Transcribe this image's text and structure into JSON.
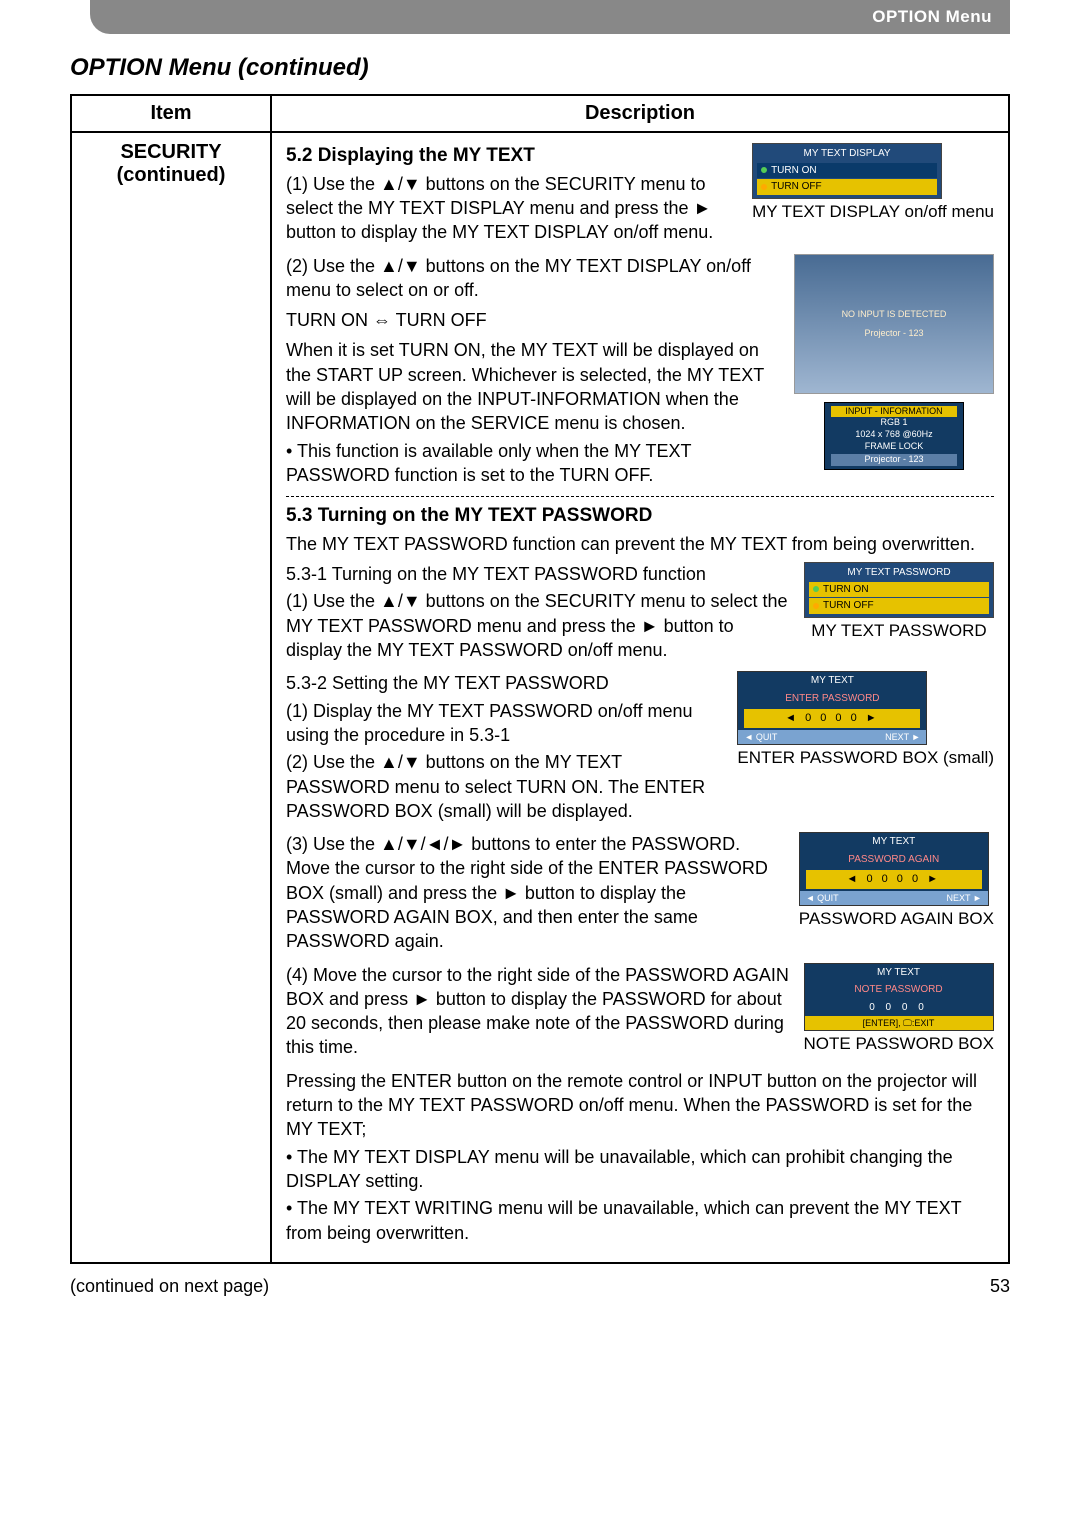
{
  "topbar": {
    "label": "OPTION Menu"
  },
  "sectionTitle": "OPTION Menu (continued)",
  "headers": {
    "item": "Item",
    "description": "Description"
  },
  "item": {
    "title": "SECURITY",
    "sub": "(continued)"
  },
  "s52": {
    "heading": "5.2 Displaying the MY TEXT",
    "p1": "(1) Use the ▲/▼ buttons on the SECURITY menu to select the MY TEXT DISPLAY menu and press the ► button to display the MY TEXT DISPLAY on/off menu.",
    "p2": "(2) Use the ▲/▼ buttons on the MY TEXT DISPLAY on/off menu to select on or off.",
    "toggle": "TURN ON ⇔ TURN OFF",
    "p3": "When it is set TURN ON, the MY TEXT will be displayed on the START UP screen. Whichever is selected, the MY TEXT will be displayed on the INPUT-INFORMATION when the INFORMATION on the SERVICE menu is chosen.",
    "p4": "• This function is available only when the MY TEXT PASSWORD function is set to the TURN OFF.",
    "fig1": {
      "title": "MY TEXT DISPLAY",
      "on": "TURN ON",
      "off": "TURN OFF",
      "caption": "MY TEXT DISPLAY on/off menu"
    },
    "fig2": {
      "screenLine1": "NO INPUT IS DETECTED",
      "screenLine2": "Projector - 123",
      "infoTitle": "INPUT - INFORMATION",
      "info1": "RGB 1",
      "info2": "1024 x 768 @60Hz",
      "info3": "FRAME LOCK",
      "info4": "Projector - 123"
    }
  },
  "s53": {
    "heading": "5.3 Turning on the MY TEXT PASSWORD",
    "intro": "The MY TEXT PASSWORD function can prevent the MY TEXT from being overwritten.",
    "h531": "5.3-1 Turning on the MY TEXT PASSWORD function",
    "p531": "(1) Use the ▲/▼ buttons on the SECURITY menu to select the MY TEXT PASSWORD menu and press the ► button to display the MY TEXT PASSWORD on/off menu.",
    "h532": "5.3-2 Setting the MY TEXT PASSWORD",
    "p532_1": "(1) Display the MY TEXT PASSWORD on/off menu using the procedure in 5.3-1",
    "p532_2": "(2) Use the ▲/▼ buttons on the MY TEXT PASSWORD menu to select TURN ON. The ENTER PASSWORD BOX (small) will be displayed.",
    "p532_3": "(3) Use the ▲/▼/◄/► buttons to enter the PASSWORD. Move the cursor to the right side of the ENTER PASSWORD BOX (small) and press the ► button to display the PASSWORD AGAIN BOX, and then enter the same PASSWORD again.",
    "p532_4": "(4) Move the cursor to the right side of the PASSWORD AGAIN BOX and press ► button to display the PASSWORD for about 20 seconds, then please make note of the PASSWORD during this time.",
    "p5": "Pressing the ENTER button on the remote control or INPUT button on the projector will return to the MY TEXT PASSWORD on/off menu. When the PASSWORD is set for the MY TEXT;",
    "b1": "• The MY TEXT DISPLAY menu will be unavailable, which can prohibit changing the DISPLAY setting.",
    "b2": "• The MY TEXT WRITING menu will be unavailable, which can prevent the MY TEXT from being overwritten.",
    "figA": {
      "title": "MY TEXT PASSWORD",
      "on": "TURN ON",
      "off": "TURN OFF",
      "caption": "MY TEXT PASSWORD"
    },
    "figB": {
      "title": "MY TEXT",
      "sub": "ENTER PASSWORD",
      "digits": "◄ 0 0 0 0 ►",
      "quit": "◄ QUIT",
      "next": "NEXT ►",
      "caption": "ENTER PASSWORD BOX (small)"
    },
    "figC": {
      "title": "MY TEXT",
      "sub": "PASSWORD AGAIN",
      "digits": "◄ 0 0 0 0 ►",
      "quit": "◄ QUIT",
      "next": "NEXT ►",
      "caption": "PASSWORD AGAIN BOX"
    },
    "figD": {
      "title": "MY TEXT",
      "sub": "NOTE PASSWORD",
      "digits": "0 0 0 0",
      "nav": "[ENTER], 🖵:EXIT",
      "caption": "NOTE PASSWORD BOX"
    }
  },
  "footer": {
    "left": "(continued on next page)",
    "page": "53"
  }
}
